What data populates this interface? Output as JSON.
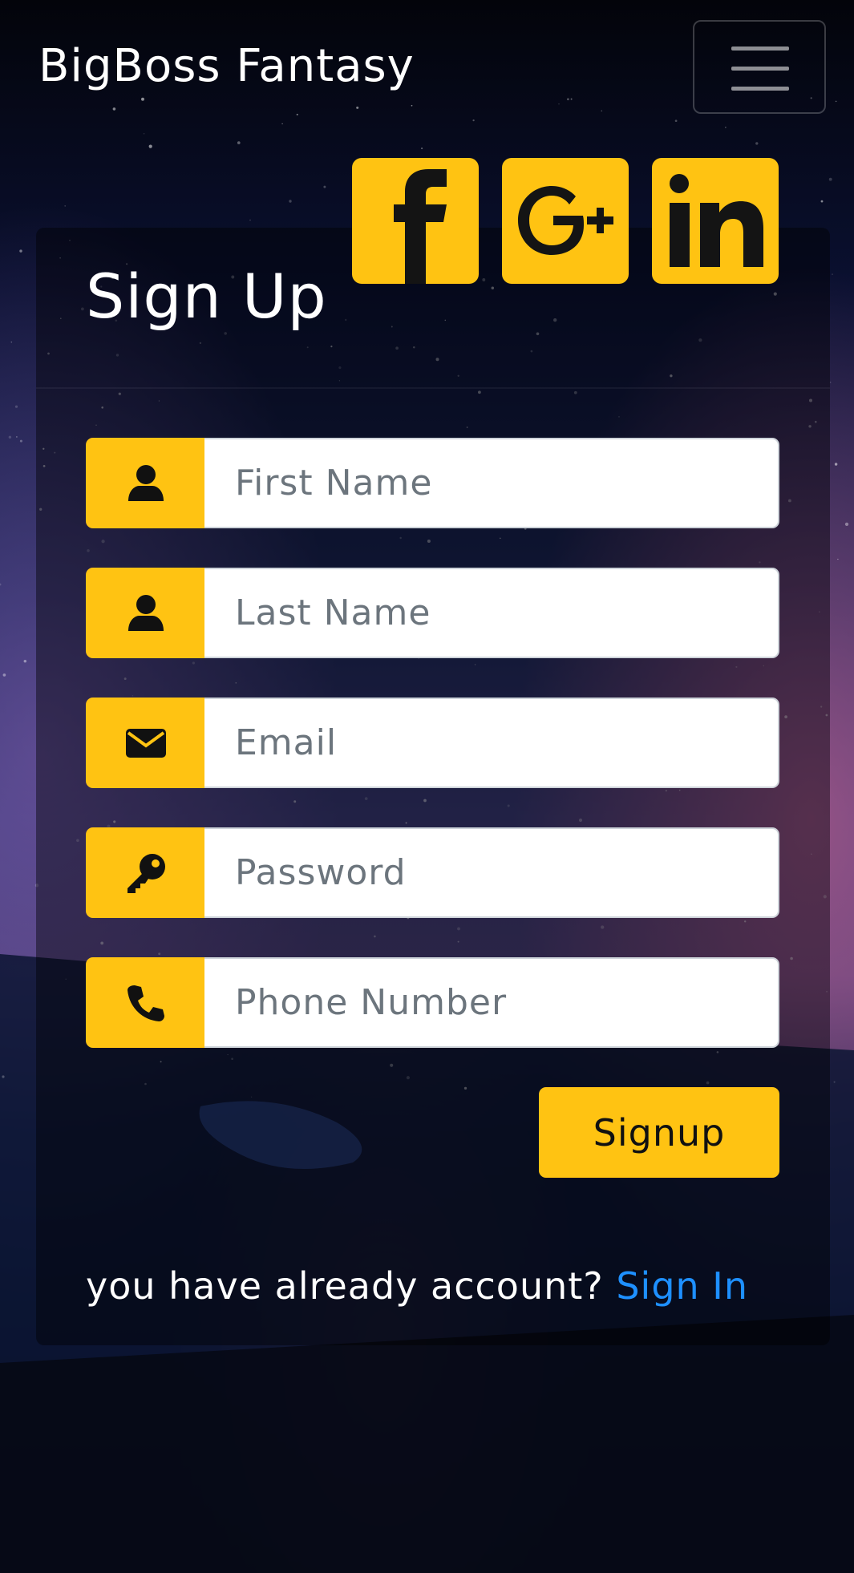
{
  "navbar": {
    "brand": "BigBoss Fantasy",
    "menu_icon": "hamburger-icon"
  },
  "card": {
    "title": "Sign Up",
    "social": [
      {
        "name": "facebook",
        "icon": "facebook-icon"
      },
      {
        "name": "google-plus",
        "icon": "google-plus-icon"
      },
      {
        "name": "linkedin",
        "icon": "linkedin-icon"
      }
    ],
    "fields": [
      {
        "icon": "user-icon",
        "placeholder": "First Name",
        "value": ""
      },
      {
        "icon": "user-icon",
        "placeholder": "Last Name",
        "value": ""
      },
      {
        "icon": "envelope-icon",
        "placeholder": "Email",
        "value": ""
      },
      {
        "icon": "key-icon",
        "placeholder": "Password",
        "value": ""
      },
      {
        "icon": "phone-icon",
        "placeholder": "Phone Number",
        "value": ""
      }
    ],
    "submit_label": "Signup",
    "footer_prompt": "you have already account?",
    "footer_link": "Sign In"
  },
  "colors": {
    "accent": "#ffc312",
    "link": "#1e90ff",
    "text": "#ffffff"
  }
}
